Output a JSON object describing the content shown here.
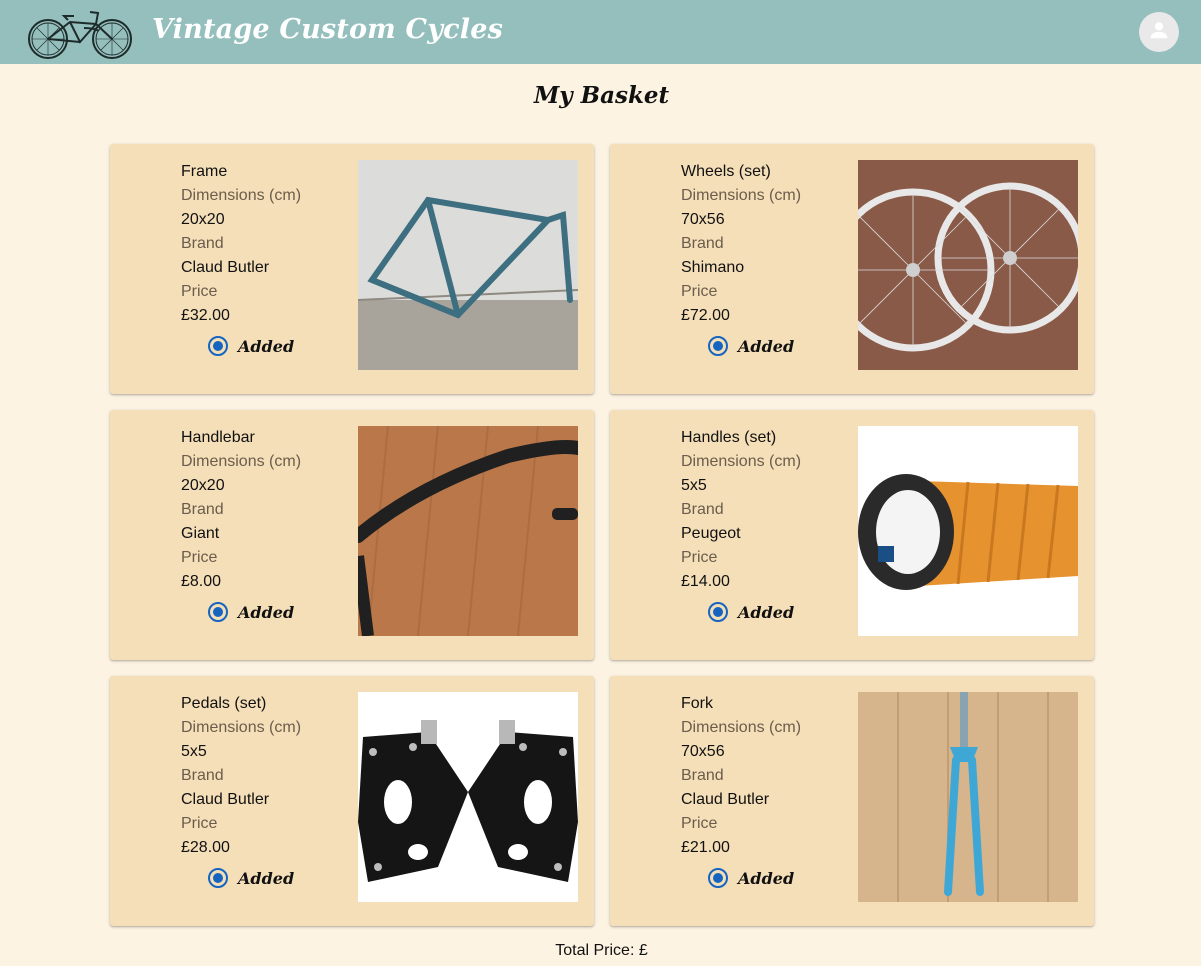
{
  "header": {
    "app_title": "Vintage Custom Cycles",
    "logo_icon": "bicycle-icon",
    "account_icon": "account-icon"
  },
  "page_title": "My Basket",
  "labels": {
    "dimensions": "Dimensions (cm)",
    "brand": "Brand",
    "price": "Price",
    "added": "Added"
  },
  "items": [
    {
      "name": "Frame",
      "dimensions": "20x20",
      "brand": "Claud Butler",
      "price": "£32.00",
      "added": true
    },
    {
      "name": "Wheels (set)",
      "dimensions": "70x56",
      "brand": "Shimano",
      "price": "£72.00",
      "added": true
    },
    {
      "name": "Handlebar",
      "dimensions": "20x20",
      "brand": "Giant",
      "price": "£8.00",
      "added": true
    },
    {
      "name": "Handles (set)",
      "dimensions": "5x5",
      "brand": "Peugeot",
      "price": "£14.00",
      "added": true
    },
    {
      "name": "Pedals (set)",
      "dimensions": "5x5",
      "brand": "Claud Butler",
      "price": "£28.00",
      "added": true
    },
    {
      "name": "Fork",
      "dimensions": "70x56",
      "brand": "Claud Butler",
      "price": "£21.00",
      "added": true
    }
  ],
  "total_label": "Total Price: £",
  "colors": {
    "appbar": "#94bfbd",
    "background": "#fdf3e3",
    "card": "#f5dfb9",
    "radio_selected": "#1565c0"
  }
}
